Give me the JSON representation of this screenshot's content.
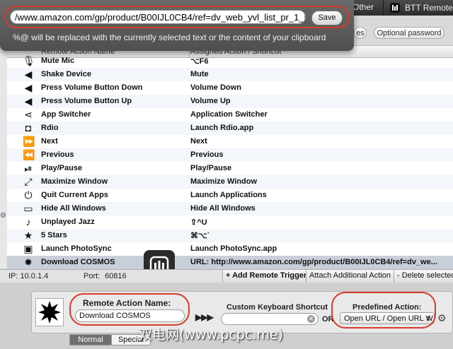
{
  "popover": {
    "url_value": "/www.amazon.com/gp/product/B00IJL0CB4/ref=dv_web_yvl_list_pr_1_ba",
    "save_label": "Save",
    "hint": "%@ will be replaced with the currently selected text or the content of your clipboard"
  },
  "tabs": {
    "other": "Other",
    "btt_remote": "BTT Remote"
  },
  "toolbar": {
    "small_btn": "es",
    "optional_password": "Optional password"
  },
  "table": {
    "col_action": "Remote Action Name",
    "col_assigned": "Assigned Action / Shortcut",
    "rows": [
      {
        "icon": "microphone-icon",
        "glyph": "🎙",
        "name": "Mute Mic",
        "assigned": "⌥F6"
      },
      {
        "icon": "speaker-icon",
        "glyph": "◀",
        "name": "Shake Device",
        "assigned": "Mute"
      },
      {
        "icon": "volume-down-icon",
        "glyph": "◀",
        "name": "Press Volume Button Down",
        "assigned": "Volume Down"
      },
      {
        "icon": "volume-up-icon",
        "glyph": "◀",
        "name": "Press Volume Button Up",
        "assigned": "Volume Up"
      },
      {
        "icon": "share-icon",
        "glyph": "⋖",
        "name": "App Switcher",
        "assigned": "Application Switcher"
      },
      {
        "icon": "rdio-icon",
        "glyph": "◘",
        "name": "Rdio",
        "assigned": "Launch Rdio.app"
      },
      {
        "icon": "next-icon",
        "glyph": "⏩",
        "name": "Next",
        "assigned": "Next"
      },
      {
        "icon": "previous-icon",
        "glyph": "⏪",
        "name": "Previous",
        "assigned": "Previous"
      },
      {
        "icon": "play-pause-icon",
        "glyph": "⏯",
        "name": "Play/Pause",
        "assigned": "Play/Pause"
      },
      {
        "icon": "maximize-icon",
        "glyph": "⤢",
        "name": "Maximize Window",
        "assigned": "Maximize Window"
      },
      {
        "icon": "power-icon",
        "glyph": "⏻",
        "name": "Quit Current Apps",
        "assigned": "Launch Applications"
      },
      {
        "icon": "monitor-icon",
        "glyph": "▭",
        "name": "Hide All Windows",
        "assigned": "Hide All Windows"
      },
      {
        "icon": "music-note-icon",
        "glyph": "♪",
        "name": "Unplayed Jazz",
        "assigned": "⇧^U"
      },
      {
        "icon": "star-icon",
        "glyph": "★",
        "name": "5 Stars",
        "assigned": "⌘⌥`"
      },
      {
        "icon": "photosync-icon",
        "glyph": "▣",
        "name": "Launch PhotoSync",
        "assigned": "Launch PhotoSync.app"
      },
      {
        "icon": "burst-icon",
        "glyph": "✹",
        "name": "Download COSMOS",
        "assigned": "URL: http://www.amazon.com/gp/product/B00IJL0CB4/ref=dv_we..."
      }
    ]
  },
  "status": {
    "ip": "IP: 10.0.1.4",
    "port_label": "Port:",
    "port_value": "60816",
    "add_trigger": "+ Add Remote Trigger",
    "attach_action": "Attach Additional Action",
    "delete_selected": "- Delete selected"
  },
  "editor": {
    "name_label": "Remote Action Name:",
    "name_value": "Download COSMOS",
    "arrows": "▶▶▶",
    "shortcut_label": "Custom Keyboard Shortcut",
    "or": "OR",
    "predefined_label": "Predefined Action:",
    "predefined_value": "Open URL / Open URL W",
    "seg_normal": "Normal",
    "seg_special": "Special"
  },
  "watermark": "双电网(www.pcpc.me)"
}
